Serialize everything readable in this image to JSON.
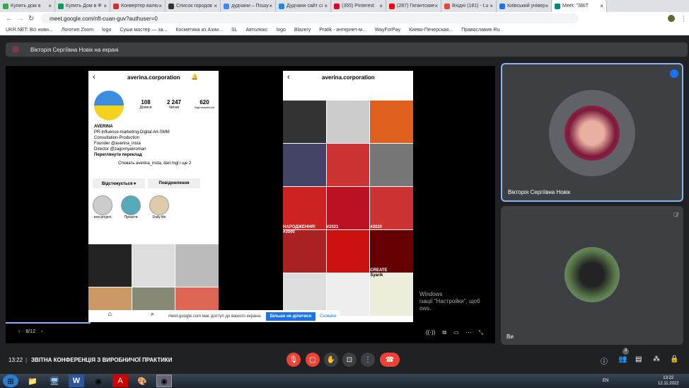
{
  "tabs": [
    {
      "label": "Купить дом в",
      "color": "#34a853"
    },
    {
      "label": "Купить Дом в Ф",
      "color": "#0f9d58"
    },
    {
      "label": "Конвертер валю",
      "color": "#d32f2f"
    },
    {
      "label": "Список городов",
      "color": "#333333"
    },
    {
      "label": "дудчани – Пошу",
      "color": "#4285f4"
    },
    {
      "label": "Дудчани сайт сі",
      "color": "#1e88e5"
    },
    {
      "label": "(355) Pinterest",
      "color": "#e60023"
    },
    {
      "label": "(287) Гигантские",
      "color": "#ff0000"
    },
    {
      "label": "Вхідні (181) - t.u",
      "color": "#ea4335"
    },
    {
      "label": "Київський універ",
      "color": "#1a73e8"
    },
    {
      "label": "Meet: \"ЗВІТ",
      "color": "#00897b",
      "active": true
    }
  ],
  "address": {
    "url": "meet.google.com/nft-cuan-guv?authuser=0"
  },
  "bookmarks": [
    "UKR.NET: Всі нови...",
    "Логотип Zoom",
    "logo",
    "Суши мастер — за...",
    "Косметика из Азии...",
    "SL",
    "Автолюкс",
    "logo",
    "Blazery",
    "Pratik - интернет-м...",
    "WayForPay",
    "Киево-Печерская...",
    "Православие.Ru"
  ],
  "banner": {
    "text": "Вікторія Сергіївна Новік на екрані"
  },
  "instagram": {
    "username": "averina.corporation",
    "posts": "108",
    "posts_label": "Дописи",
    "followers": "2 247",
    "followers_label": "Читачі",
    "following": "620",
    "following_label": "Відстежуються",
    "name": "AVERINA",
    "bio": [
      "PR-Influence-marketing-Digital Art-SMM",
      "Consultation-Production",
      "Founder @averina_insta",
      "Director @zagornyakroman"
    ],
    "translate": "Переглянути переклад",
    "followed_by": "Стежать averina_insta, dari.mgl і ще 2",
    "follow_button": "Відстежується ▾",
    "message_button": "Повідомлення",
    "highlights": [
      "eee.project",
      "Проєкти",
      "Daily life"
    ],
    "grid_labels": [
      "НАРОДЖЕННЯ!",
      "#2021",
      "#2020",
      "#3000",
      "CREATE",
      "Syarik"
    ]
  },
  "share_notice": {
    "text": "meet.google.com має доступ до вашого екрана.",
    "stop": "Більше не ділитися",
    "hide": "Сховати"
  },
  "activate": {
    "line1": "Windows",
    "line2": "ізації \"Настройки\", щоб",
    "line3": "ows."
  },
  "pager": "8/12",
  "participants": [
    {
      "name": "Вікторія Сергіївна Новік"
    },
    {
      "name": "Ви"
    }
  ],
  "meeting": {
    "time": "13:22",
    "title": "ЗВІТНА КОНФЕРЕНЦІЯ З ВИРОБНИЧОЇ ПРАКТИКИ",
    "participant_count": "3"
  },
  "tray": {
    "lang": "EN",
    "time": "13:22",
    "date": "12.11.2022"
  },
  "colors": {
    "meet_bg": "#202124",
    "end_call": "#ea4335",
    "active_border": "#8ab4f8",
    "share_button": "#1a73e8"
  }
}
